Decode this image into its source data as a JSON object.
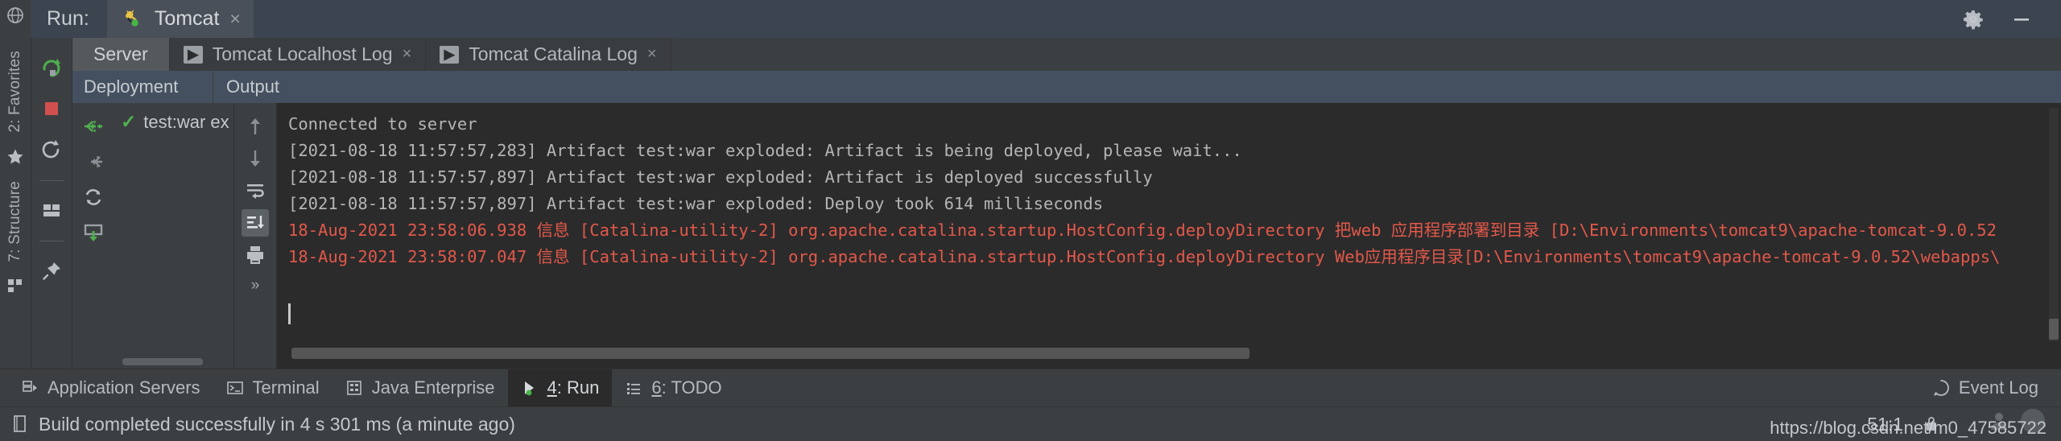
{
  "titlebar": {
    "run_label": "Run:",
    "tab": {
      "label": "Tomcat",
      "icon": "tomcat-cat-icon",
      "close": "×"
    },
    "settings_icon": "gear-icon",
    "minimize_icon": "minimize-icon"
  },
  "run_toolbar": [
    {
      "name": "rerun-button",
      "icon": "rerun-icon"
    },
    {
      "name": "stop-button",
      "icon": "stop-square-icon"
    },
    {
      "name": "restart-button",
      "icon": "restart-circle-icon"
    },
    {
      "name": "layout-button",
      "icon": "layout-icon"
    },
    {
      "name": "pin-button",
      "icon": "pin-icon"
    }
  ],
  "left_bar": {
    "favorites_label": "2: Favorites",
    "favorites_key": "2",
    "structure_label": "7: Structure",
    "structure_key": "7",
    "star_icon": "star-icon",
    "structure_icon": "structure-icon"
  },
  "tabs": [
    {
      "label": "Server",
      "active": true,
      "closable": false,
      "icon": null
    },
    {
      "label": "Tomcat Localhost Log",
      "active": false,
      "closable": true,
      "icon": "console-badge-icon",
      "close": "×"
    },
    {
      "label": "Tomcat Catalina Log",
      "active": false,
      "closable": true,
      "icon": "console-badge-icon",
      "close": "×"
    }
  ],
  "headers": {
    "deployment": "Deployment",
    "output": "Output"
  },
  "deployment": {
    "tools": [
      {
        "name": "deploy-all-button",
        "icon": "deploy-green-icon"
      },
      {
        "name": "undeploy-button",
        "icon": "undeploy-gray-icon"
      },
      {
        "name": "redeploy-button",
        "icon": "redeploy-icon"
      },
      {
        "name": "deploy-artifact-button",
        "icon": "deploy-down-icon"
      }
    ],
    "nodes": [
      {
        "status_icon": "check-icon",
        "label": "test:war ex"
      }
    ]
  },
  "console_tools": [
    {
      "name": "scroll-up-button",
      "icon": "arrow-up-icon",
      "selected": false
    },
    {
      "name": "scroll-down-button",
      "icon": "arrow-down-icon",
      "selected": false
    },
    {
      "name": "soft-wrap-button",
      "icon": "soft-wrap-icon",
      "selected": false
    },
    {
      "name": "scroll-to-end-button",
      "icon": "scroll-to-end-icon",
      "selected": true
    },
    {
      "name": "print-button",
      "icon": "printer-icon",
      "selected": false
    },
    {
      "name": "more-button",
      "icon": "chevron-double-right-icon",
      "selected": false
    }
  ],
  "console": {
    "lines": [
      {
        "text": "Connected to server",
        "level": "info"
      },
      {
        "text": "[2021-08-18 11:57:57,283] Artifact test:war exploded: Artifact is being deployed, please wait...",
        "level": "info"
      },
      {
        "text": "[2021-08-18 11:57:57,897] Artifact test:war exploded: Artifact is deployed successfully",
        "level": "info"
      },
      {
        "text": "[2021-08-18 11:57:57,897] Artifact test:war exploded: Deploy took 614 milliseconds",
        "level": "info"
      },
      {
        "text": "18-Aug-2021 23:58:06.938 信息 [Catalina-utility-2] org.apache.catalina.startup.HostConfig.deployDirectory 把web 应用程序部署到目录 [D:\\Environments\\tomcat9\\apache-tomcat-9.0.52",
        "level": "error"
      },
      {
        "text": "18-Aug-2021 23:58:07.047 信息 [Catalina-utility-2] org.apache.catalina.startup.HostConfig.deployDirectory Web应用程序目录[D:\\Environments\\tomcat9\\apache-tomcat-9.0.52\\webapps\\",
        "level": "error"
      }
    ],
    "colors": {
      "info": "#b5b5b5",
      "error": "#e2584a",
      "background": "#2b2b2b"
    }
  },
  "bottom_bar": {
    "items": [
      {
        "label": "Application Servers",
        "icon": "application-servers-icon",
        "active": false
      },
      {
        "label": "Terminal",
        "icon": "terminal-icon",
        "active": false
      },
      {
        "label": "Java Enterprise",
        "icon": "java-enterprise-icon",
        "active": false
      },
      {
        "label": "4: Run",
        "key": "4",
        "suffix": ": Run",
        "icon": "run-play-icon",
        "active": true
      },
      {
        "label": "6: TODO",
        "key": "6",
        "suffix": ": TODO",
        "icon": "todo-list-icon",
        "active": false
      }
    ],
    "event_log": {
      "label": "Event Log",
      "icon": "event-log-icon"
    }
  },
  "status_bar": {
    "icon": "build-icon",
    "message": "Build completed successfully in 4 s 301 ms (a minute ago)",
    "position": "51:1",
    "lock_icon": "lock-icon",
    "watermark": "https://blog.csdn.net/m0_47585722"
  }
}
